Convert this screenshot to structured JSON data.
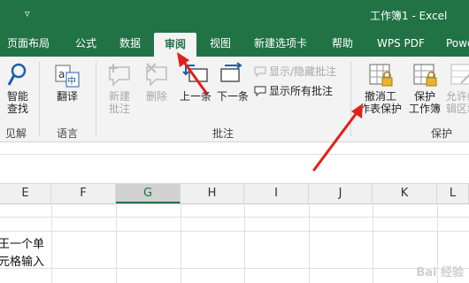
{
  "titlebar": {
    "dropdown_glyph": "▿",
    "title": "工作簿1  -  Excel"
  },
  "tabs": [
    {
      "label": "页面布局",
      "active": false
    },
    {
      "label": "公式",
      "active": false
    },
    {
      "label": "数据",
      "active": false
    },
    {
      "label": "审阅",
      "active": true
    },
    {
      "label": "视图",
      "active": false
    },
    {
      "label": "新建选项卡",
      "active": false
    },
    {
      "label": "帮助",
      "active": false
    },
    {
      "label": "WPS PDF",
      "active": false
    },
    {
      "label": "Powe",
      "active": false
    }
  ],
  "ribbon": {
    "groups": {
      "insights": "见解",
      "language": "语言",
      "comments": "批注",
      "protect": "保护"
    },
    "smart_lookup": {
      "line1": "智能",
      "line2": "查找"
    },
    "translate": {
      "label": "翻译"
    },
    "new_comment": {
      "line1": "新建",
      "line2": "批注"
    },
    "delete": {
      "label": "删除"
    },
    "prev": {
      "label": "上一条"
    },
    "next": {
      "label": "下一条"
    },
    "show_hide_comment": "显示/隐藏批注",
    "show_all_comments": "显示所有批注",
    "unprotect_sheet": {
      "line1": "撤消工",
      "line2": "作表保护"
    },
    "protect_workbook": {
      "line1": "保护",
      "line2": "工作簿"
    },
    "allow_edit_ranges": {
      "line1": "允许编",
      "line2": "辑区域"
    }
  },
  "columns": [
    "E",
    "F",
    "G",
    "H",
    "I",
    "J",
    "K",
    "L"
  ],
  "selected_column": "G",
  "cells": {
    "E5_line1": "王一个单",
    "E5_line2": "元格输入"
  },
  "watermark": "Bai 经验",
  "colors": {
    "excel_green": "#217346",
    "annotation_arrow": "#e0201b"
  }
}
